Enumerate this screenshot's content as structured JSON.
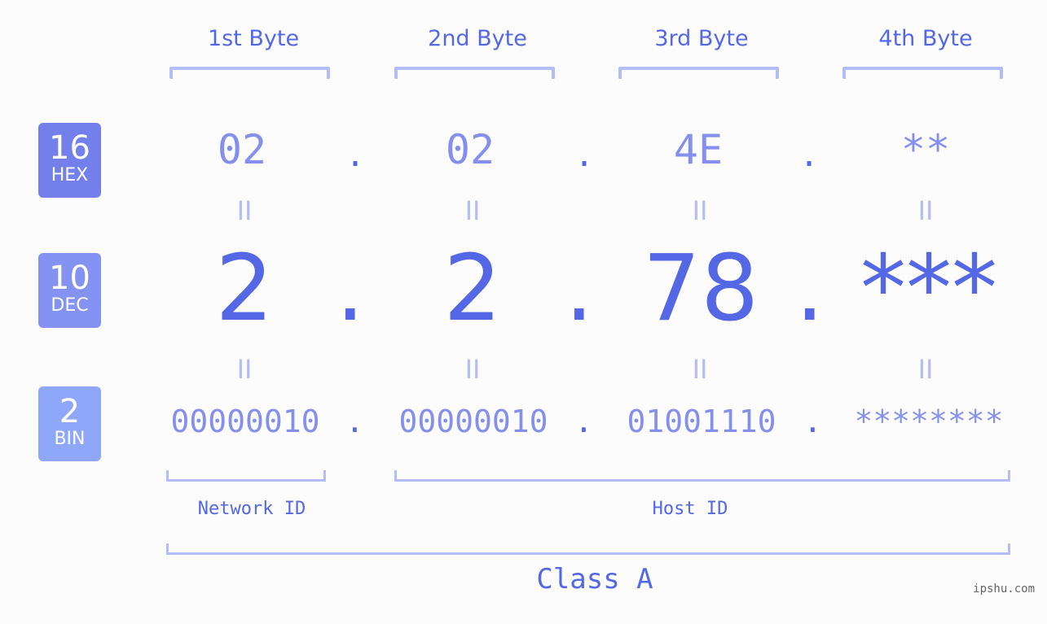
{
  "bytes": {
    "headers": [
      "1st Byte",
      "2nd Byte",
      "3rd Byte",
      "4th Byte"
    ]
  },
  "badges": {
    "hex": {
      "num": "16",
      "tag": "HEX",
      "color": "#7380eb"
    },
    "dec": {
      "num": "10",
      "tag": "DEC",
      "color": "#8492f1"
    },
    "bin": {
      "num": "2",
      "tag": "BIN",
      "color": "#8fa7f9"
    }
  },
  "hex": {
    "values": [
      "02",
      "02",
      "4E",
      "**"
    ],
    "separator": "."
  },
  "dec": {
    "values": [
      "2",
      "2",
      "78",
      "***"
    ],
    "separator": "."
  },
  "bin": {
    "values": [
      "00000010",
      "00000010",
      "01001110",
      "********"
    ],
    "separator": "."
  },
  "equals": "II",
  "ids": {
    "network": "Network ID",
    "host": "Host ID"
  },
  "class_label": "Class A",
  "watermark": "ipshu.com",
  "colors": {
    "accent": "#5468e6",
    "light": "#8590ee",
    "bracket": "#b3bdf7",
    "background": "#fbfcfb"
  }
}
